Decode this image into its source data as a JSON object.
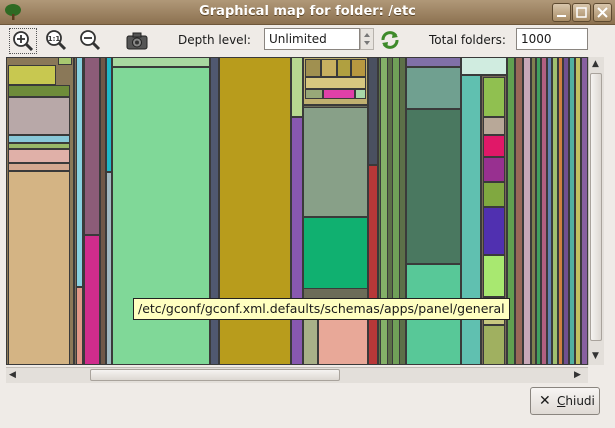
{
  "window": {
    "title": "Graphical map for folder: /etc",
    "icons": {
      "app": "tree-icon",
      "minimize": "minimize-icon",
      "maximize": "maximize-icon",
      "close": "close-icon"
    }
  },
  "toolbar": {
    "buttons": [
      {
        "name": "zoom-in",
        "icon": "zoom-in-icon"
      },
      {
        "name": "zoom-fit",
        "icon": "zoom-100-icon",
        "glyph": "1:1"
      },
      {
        "name": "zoom-out",
        "icon": "zoom-out-icon"
      },
      {
        "name": "screenshot",
        "icon": "camera-icon"
      }
    ],
    "depth_label": "Depth level:",
    "depth_value": "Unlimited",
    "refresh_icon": "refresh-icon",
    "total_label": "Total folders:",
    "total_value": "1000"
  },
  "map": {
    "tooltip": "/etc/gconf/gconf.xml.defaults/schemas/apps/panel/general"
  },
  "footer": {
    "close_label": "Chiudi",
    "close_mnemonic": "C"
  }
}
